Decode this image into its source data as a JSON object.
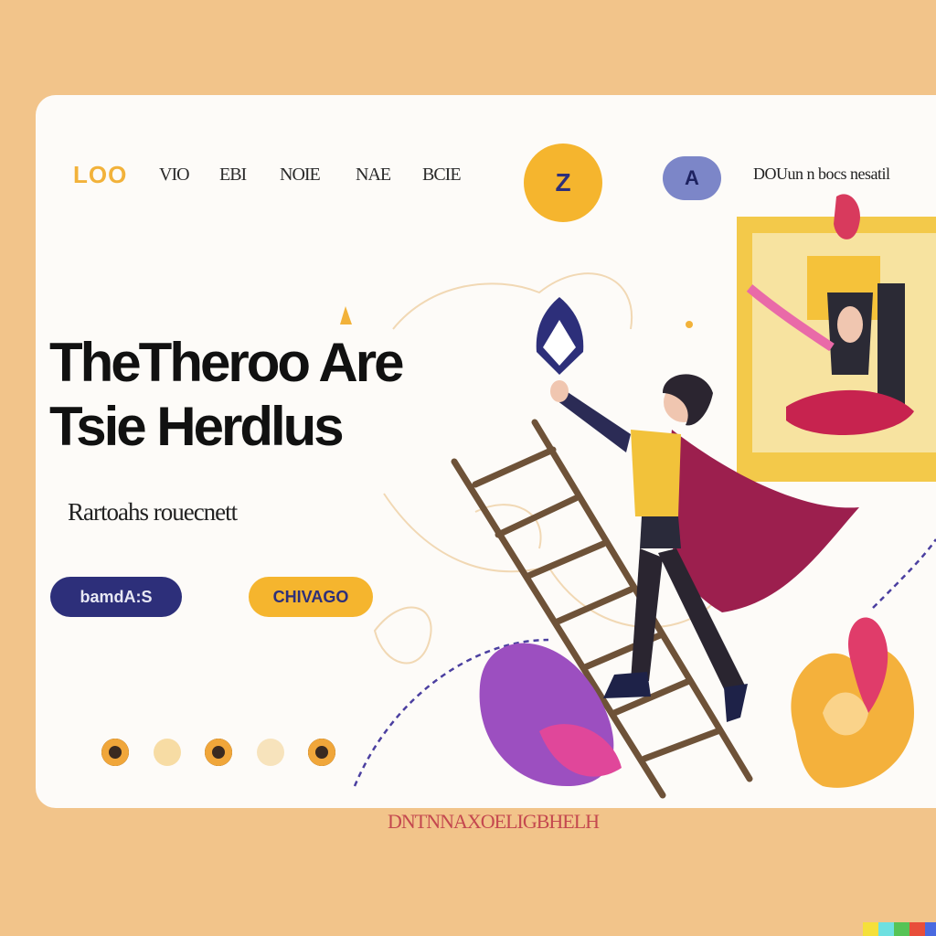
{
  "nav": {
    "logo": "LOO",
    "links": [
      "VIO",
      "EBI",
      "NOIE",
      "NAE",
      "BCIE"
    ],
    "center_button_label": "Z",
    "icon_button_label": "A",
    "right_text": "DOUun n bocs nesatil"
  },
  "hero": {
    "title_line1": "TheTheroo Are",
    "title_line2": "Tsie Herdlus",
    "subtitle": "Rartoahs rouecnett"
  },
  "buttons": {
    "primary_label": "bamdA:S",
    "secondary_label": "CHIVAGO"
  },
  "footer_text": "DNTNNAXOELIGBHELH",
  "colors": {
    "background": "#f2c48a",
    "card": "#fdfbf8",
    "accent_yellow": "#f5b52e",
    "accent_navy": "#2d2f7a",
    "accent_magenta": "#b2245a"
  }
}
